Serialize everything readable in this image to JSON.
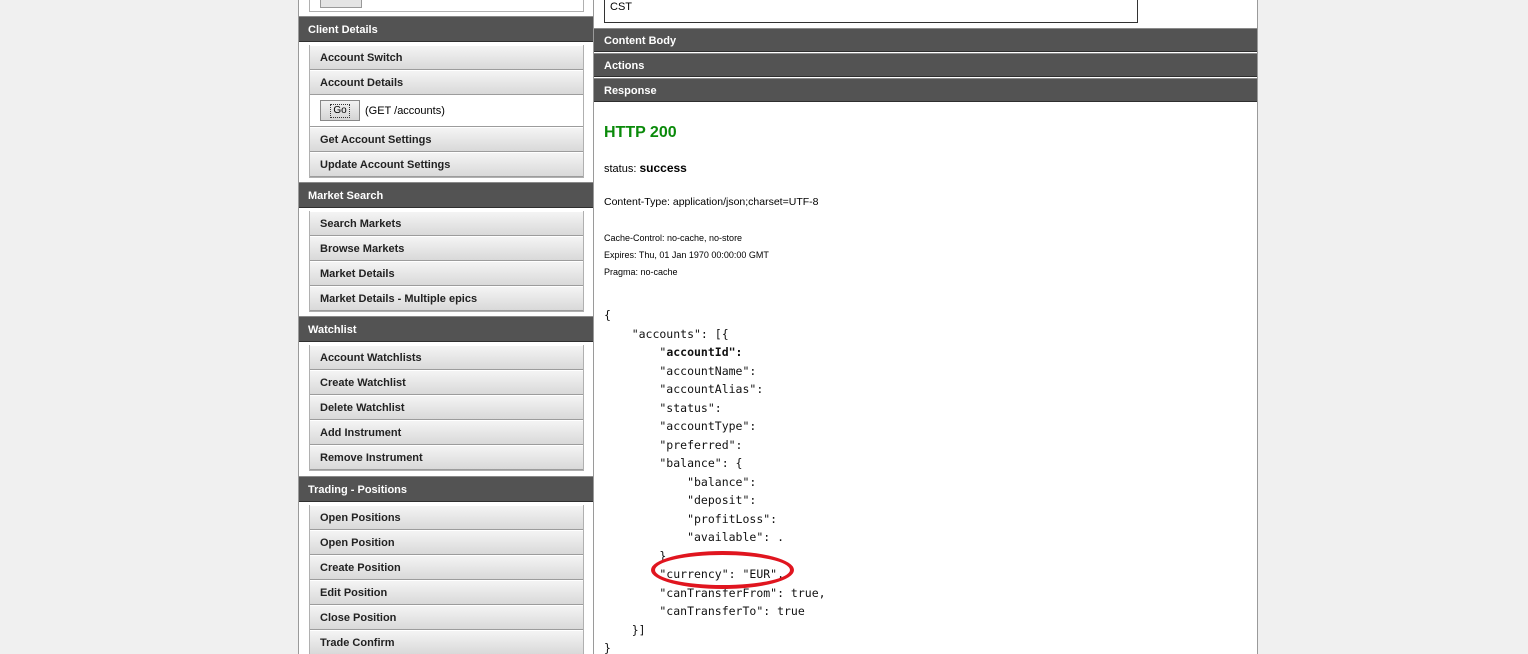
{
  "left": {
    "client_details": {
      "title": "Client Details",
      "items": [
        "Account Switch",
        "Account Details"
      ],
      "open_item": {
        "go_label": "Go",
        "endpoint": "(GET /accounts)"
      },
      "items_after": [
        "Get Account Settings",
        "Update Account Settings"
      ]
    },
    "market_search": {
      "title": "Market Search",
      "items": [
        "Search Markets",
        "Browse Markets",
        "Market Details",
        "Market Details - Multiple epics"
      ]
    },
    "watchlist": {
      "title": "Watchlist",
      "items": [
        "Account Watchlists",
        "Create Watchlist",
        "Delete Watchlist",
        "Add Instrument",
        "Remove Instrument"
      ]
    },
    "trading_positions": {
      "title": "Trading - Positions",
      "items": [
        "Open Positions",
        "Open Position",
        "Create Position",
        "Edit Position",
        "Close Position",
        "Trade Confirm"
      ]
    }
  },
  "right": {
    "cst_value": "CST",
    "sections": [
      "Content Body",
      "Actions",
      "Response"
    ],
    "response": {
      "http_status": "HTTP 200",
      "status_label": "status:",
      "status_value": "success",
      "content_type": "Content-Type: application/json;charset=UTF-8",
      "headers": [
        "Cache-Control: no-cache, no-store",
        "Expires: Thu, 01 Jan 1970 00:00:00 GMT",
        "Pragma: no-cache"
      ],
      "json_lines": [
        "{",
        "    \"accounts\": [{",
        "        \"accountId\":",
        "        \"accountName\":",
        "        \"accountAlias\":",
        "        \"status\":",
        "        \"accountType\":",
        "        \"preferred\":",
        "        \"balance\": {",
        "            \"balance\":",
        "            \"deposit\":",
        "            \"profitLoss\":",
        "            \"available\": .",
        "        }",
        "        \"currency\": \"EUR\",",
        "        \"canTransferFrom\": true,",
        "        \"canTransferTo\": true",
        "    }]",
        "}"
      ]
    },
    "annotation_color": "#e0151f",
    "status_color": "#0a8a0a"
  }
}
